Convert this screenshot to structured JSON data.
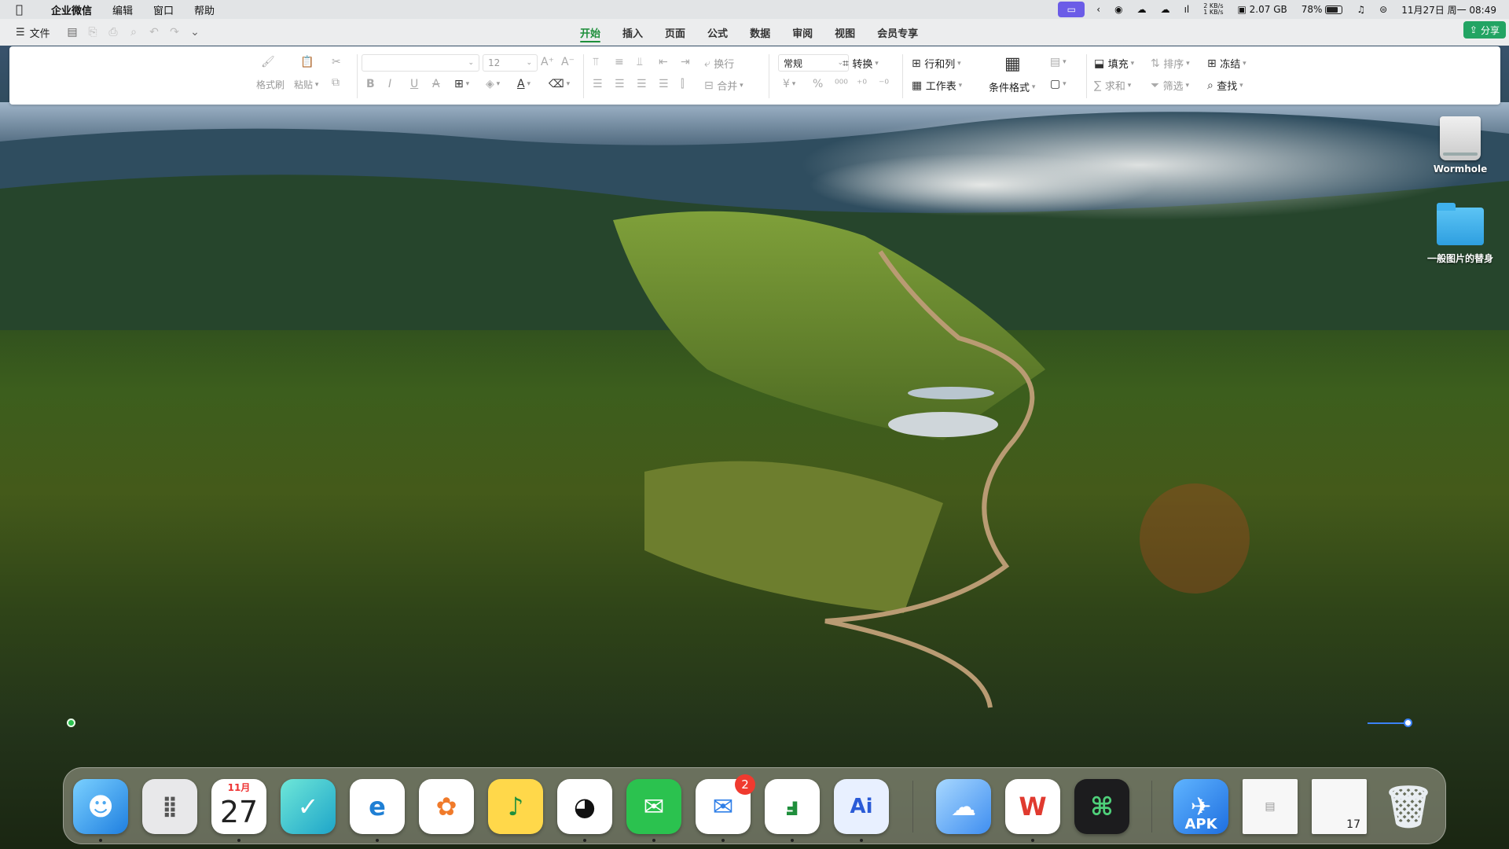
{
  "menubar": {
    "apple_icon": "apple-icon",
    "app_name": "企业微信",
    "items": [
      "编辑",
      "窗口",
      "帮助"
    ],
    "net_up": "2 KB/s",
    "net_down": "1 KB/s",
    "memory": "2.07 GB",
    "battery": "78%",
    "datetime": "11月27日 周一 08:49"
  },
  "appbar": {
    "file_label": "文件",
    "tabs": [
      "开始",
      "插入",
      "页面",
      "公式",
      "数据",
      "审阅",
      "视图",
      "会员专享"
    ],
    "active_tab": "开始",
    "share_label": "分享"
  },
  "ribbon": {
    "format_painter": "格式刷",
    "paste": "粘贴",
    "font_size": "12",
    "wrap": "换行",
    "merge": "合并",
    "number_format": "常规",
    "convert": "转换",
    "rows_cols": "行和列",
    "worksheet": "工作表",
    "conditional_format": "条件格式",
    "fill": "填充",
    "sort": "排序",
    "freeze": "冻结",
    "sum": "求和",
    "filter": "筛选",
    "find": "查找",
    "currency_symbol": "¥",
    "percent_symbol": "%"
  },
  "desktop_icons": [
    {
      "label": "Wormhole",
      "icon": "disk-icon"
    },
    {
      "label": "一般图片的替身",
      "icon": "folder-icon"
    }
  ],
  "dock": {
    "calendar_month": "11月",
    "calendar_day": "27",
    "messages_badge": "2",
    "apk_label": "APK",
    "recent_calendar_day": "17",
    "colors": {
      "accent_green": "#1f8f3c",
      "share_green": "#22a463",
      "badge_red": "#f03a2f"
    }
  }
}
